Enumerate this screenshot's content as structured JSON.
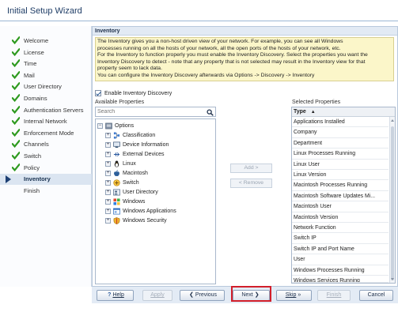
{
  "window": {
    "title": "Initial Setup Wizard"
  },
  "sidebar": {
    "items": [
      {
        "label": "Welcome",
        "state": "done"
      },
      {
        "label": "License",
        "state": "done"
      },
      {
        "label": "Time",
        "state": "done"
      },
      {
        "label": "Mail",
        "state": "done"
      },
      {
        "label": "User Directory",
        "state": "done"
      },
      {
        "label": "Domains",
        "state": "done"
      },
      {
        "label": "Authentication Servers",
        "state": "done"
      },
      {
        "label": "Internal Network",
        "state": "done"
      },
      {
        "label": "Enforcement Mode",
        "state": "done"
      },
      {
        "label": "Channels",
        "state": "done"
      },
      {
        "label": "Switch",
        "state": "done"
      },
      {
        "label": "Policy",
        "state": "done"
      },
      {
        "label": "Inventory",
        "state": "active"
      },
      {
        "label": "Finish",
        "state": "pending"
      }
    ]
  },
  "section": {
    "title": "Inventory",
    "description_lines": [
      "The Inventory gives you a non-host driven view of your network. For example, you can see all Windows",
      "processes running on all the hosts of your network, all the open ports of the hosts of your network, etc.",
      "For the Inventory to function properly you must enable the Inventory Discovery. Select the properties you want the",
      "Inventory Discovery to detect - note that any property that is not selected may result in the Inventory view for that",
      "property seem to lack data.",
      "You can configure the Inventory Discovery afterwards via Options -> Discovery -> Inventory"
    ],
    "enable_label": "Enable Inventory Discovery",
    "enable_checked": true
  },
  "available": {
    "label": "Available Properties",
    "search_placeholder": "Search",
    "root": "Options",
    "items": [
      {
        "label": "Classification",
        "icon": "classification-icon"
      },
      {
        "label": "Device Information",
        "icon": "device-info-icon"
      },
      {
        "label": "External Devices",
        "icon": "usb-icon"
      },
      {
        "label": "Linux",
        "icon": "linux-icon"
      },
      {
        "label": "Macintosh",
        "icon": "apple-icon"
      },
      {
        "label": "Switch",
        "icon": "switch-icon"
      },
      {
        "label": "User Directory",
        "icon": "user-directory-icon"
      },
      {
        "label": "Windows",
        "icon": "windows-icon"
      },
      {
        "label": "Windows Applications",
        "icon": "windows-apps-icon"
      },
      {
        "label": "Windows Security",
        "icon": "shield-icon"
      }
    ]
  },
  "transfer": {
    "add_label": "Add >",
    "remove_label": "< Remove"
  },
  "selected": {
    "label": "Selected Properties",
    "column_header": "Type",
    "sort": "ascending",
    "items": [
      "Applications Installed",
      "Company",
      "Department",
      "Linux Processes Running",
      "Linux User",
      "Linux Version",
      "Macintosh Processes Running",
      "Macintosh Software Updates Mi...",
      "Macintosh User",
      "Macintosh Version",
      "Network Function",
      "Switch IP",
      "Switch IP and Port Name",
      "User",
      "Windows Processes Running",
      "Windows Services Running"
    ]
  },
  "footer": {
    "help": "Help",
    "apply": "Apply",
    "previous": "Previous",
    "next": "Next",
    "skip": "Skip",
    "finish": "Finish",
    "cancel": "Cancel"
  },
  "colors": {
    "accent": "#1f3d66",
    "check": "#2e9a1f",
    "focus": "#d21f2b",
    "info_bg": "#fbf6c9"
  }
}
